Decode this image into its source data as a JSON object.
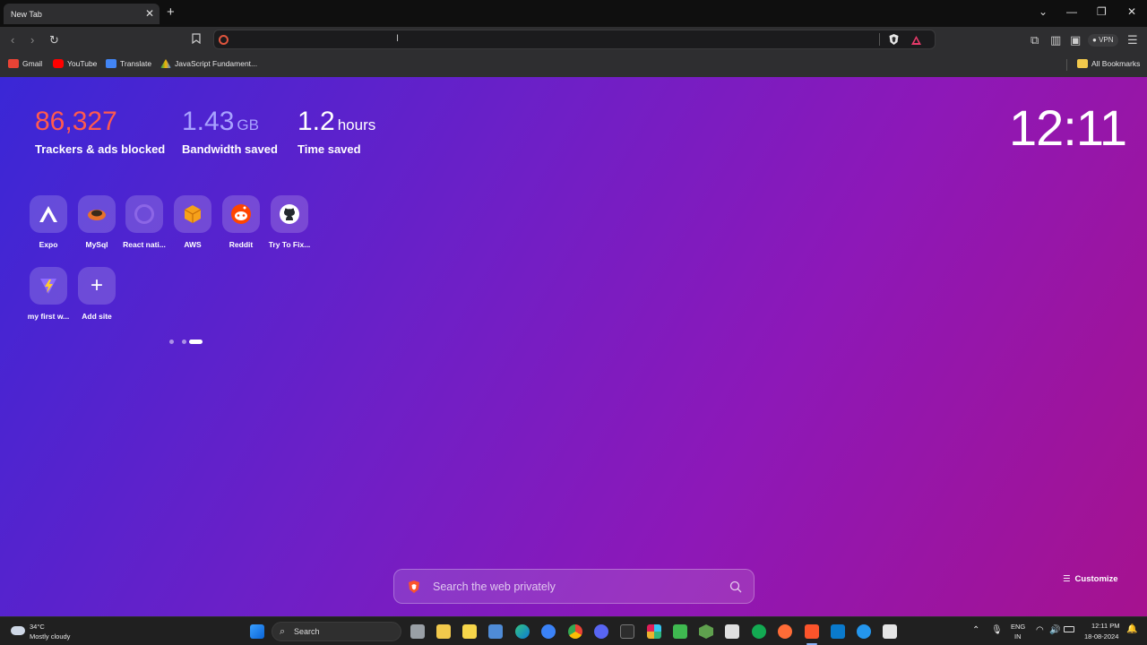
{
  "browser": {
    "tab_title": "New Tab",
    "bookmarks": [
      {
        "label": "Gmail",
        "color": "#ea4335"
      },
      {
        "label": "YouTube",
        "color": "#ff0000"
      },
      {
        "label": "Translate",
        "color": "#4285f4"
      },
      {
        "label": "JavaScript Fundament...",
        "color": "#f4b400"
      }
    ],
    "all_bookmarks_label": "All Bookmarks",
    "vpn_label": "VPN"
  },
  "stats": {
    "trackers": {
      "value": "86,327",
      "label": "Trackers & ads blocked",
      "color": "#ff5a4e"
    },
    "bandwidth": {
      "value": "1.43",
      "unit": "GB",
      "label": "Bandwidth saved",
      "color": "#a8a2ff"
    },
    "time": {
      "value": "1.2",
      "unit": "hours",
      "label": "Time saved",
      "color": "#ffffff"
    }
  },
  "clock": "12:11",
  "top_sites": [
    {
      "label": "Expo",
      "icon": "expo-icon"
    },
    {
      "label": "MySql",
      "icon": "mysql-icon"
    },
    {
      "label": "React nati...",
      "icon": "react-native-icon"
    },
    {
      "label": "AWS",
      "icon": "aws-icon"
    },
    {
      "label": "Reddit",
      "icon": "reddit-icon"
    },
    {
      "label": "Try To Fix...",
      "icon": "github-icon"
    },
    {
      "label": "my first w...",
      "icon": "vite-icon"
    },
    {
      "label": "Add site",
      "icon": "plus-icon"
    }
  ],
  "search": {
    "placeholder": "Search the web privately"
  },
  "customize_label": "Customize",
  "taskbar": {
    "weather_temp": "34°C",
    "weather_desc": "Mostly cloudy",
    "search_label": "Search",
    "lang_top": "ENG",
    "lang_bottom": "IN",
    "time": "12:11 PM",
    "date": "18-08-2024"
  }
}
